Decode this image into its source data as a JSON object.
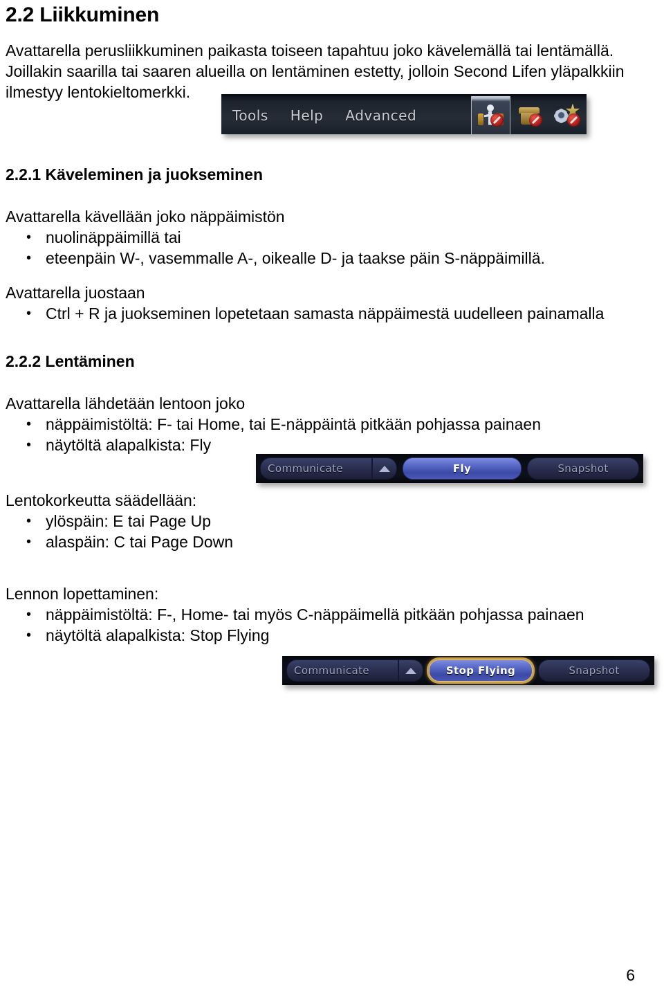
{
  "document": {
    "page_number": "6",
    "headings": {
      "h2_main": "2.2 Liikkuminen",
      "h3_walking": "2.2.1 Käveleminen ja juokseminen",
      "h3_flying": "2.2.2 Lentäminen"
    },
    "intro_paragraph": "Avattarella perusliikkuminen paikasta toiseen tapahtuu joko kävelemällä tai lentämällä. Joillakin saarilla tai saaren alueilla on lentäminen estetty, jolloin Second Lifen yläpalkkiin ilmestyy lentokieltomerkki.",
    "walking": {
      "lead_in": "Avattarella kävellään joko näppäimistön",
      "items": [
        "nuolinäppäimillä tai",
        "eteenpäin W-, vasemmalle A-, oikealle D- ja taakse päin S-näppäimillä."
      ],
      "run_lead_in": "Avattarella juostaan",
      "run_items": [
        "Ctrl + R ja juokseminen lopetetaan samasta näppäimestä uudelleen painamalla"
      ]
    },
    "flying": {
      "start_lead_in": "Avattarella lähdetään lentoon joko",
      "start_items": [
        "näppäimistöltä: F- tai Home, tai E-näppäintä pitkään pohjassa painaen",
        "näytöltä alapalkista: Fly"
      ],
      "altitude_lead_in": "Lentokorkeutta säädellään:",
      "altitude_items": [
        "ylöspäin: E tai Page Up",
        "alaspäin: C tai Page Down"
      ],
      "stop_lead_in": "Lennon lopettaminen:",
      "stop_items": [
        "näppäimistöltä: F-, Home- tai myös C-näppäimellä pitkään pohjassa painaen",
        "näytöltä alapalkista: Stop Flying"
      ]
    },
    "bullet_glyph": "•"
  },
  "screenshots": {
    "menubar": {
      "caption_role": "second-life-menu-bar-with-no-fly-indicator",
      "menu_items": [
        "Tools",
        "Help",
        "Advanced"
      ],
      "status_icons": [
        {
          "name": "no-fly-icon",
          "label": "Fly disabled",
          "selected": true
        },
        {
          "name": "no-build-icon",
          "label": "Build disabled",
          "selected": false
        },
        {
          "name": "no-script-icon",
          "label": "Scripts disabled",
          "selected": false
        }
      ],
      "colors": {
        "bar_background": "#242a34",
        "menu_text": "#c9ccd2",
        "badge_red": "#b4201c",
        "selection_highlight": "#aeb6c4"
      }
    },
    "bottombar_fly": {
      "caption_role": "second-life-bottom-bar-fly-button",
      "buttons": [
        {
          "name": "communicate-button",
          "label": "Communicate",
          "state": "normal"
        },
        {
          "name": "communicate-expand-arrow",
          "label": "",
          "state": "normal"
        },
        {
          "name": "fly-button",
          "label": "Fly",
          "state": "primary"
        },
        {
          "name": "snapshot-button",
          "label": "Snapshot",
          "state": "normal"
        }
      ],
      "colors": {
        "bar_background": "#0b0e16",
        "button_blue": "#4a58b8",
        "button_text": "#b9c0d6"
      }
    },
    "bottombar_stop_flying": {
      "caption_role": "second-life-bottom-bar-stop-flying-button",
      "buttons": [
        {
          "name": "communicate-button",
          "label": "Communicate",
          "state": "normal"
        },
        {
          "name": "communicate-expand-arrow",
          "label": "",
          "state": "normal"
        },
        {
          "name": "stop-flying-button",
          "label": "Stop Flying",
          "state": "primary-focused"
        },
        {
          "name": "snapshot-button",
          "label": "Snapshot",
          "state": "normal"
        }
      ],
      "colors": {
        "bar_background": "#0b0e16",
        "button_blue": "#4a58b8",
        "focus_ring_gold": "#c9a04e",
        "button_text": "#b9c0d6"
      }
    }
  }
}
